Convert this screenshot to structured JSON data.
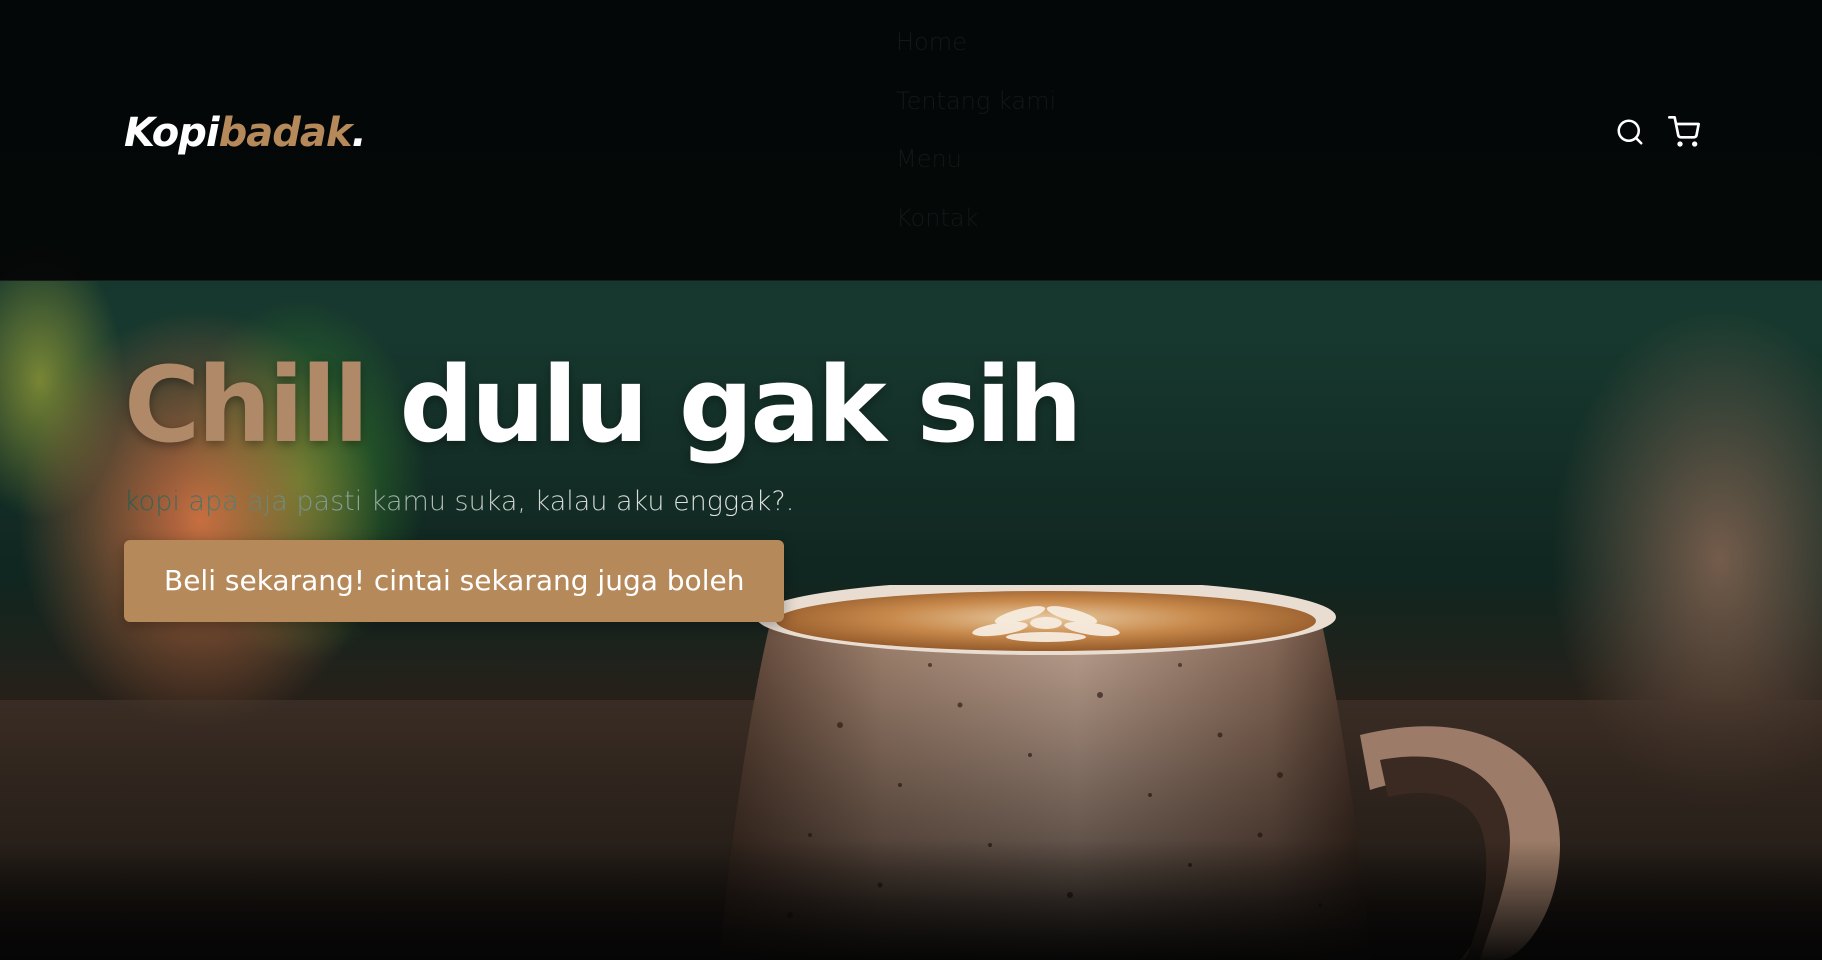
{
  "brand": {
    "name_primary": "Kopi",
    "name_accent": "badak",
    "name_suffix": ".",
    "accent_color": "#b6895b"
  },
  "nav": {
    "items": [
      {
        "label": "Home"
      },
      {
        "label": "Tentang kami"
      },
      {
        "label": "Menu"
      },
      {
        "label": "Kontak"
      }
    ],
    "icons": [
      "search-icon",
      "shopping-cart-icon"
    ]
  },
  "hero": {
    "title_accent": "Chill",
    "title_rest": " dulu gak sih",
    "subtitle": "kopi apa aja pasti kamu suka, kalau aku enggak?.",
    "cta_label": "Beli sekarang! cintai sekarang juga boleh"
  }
}
